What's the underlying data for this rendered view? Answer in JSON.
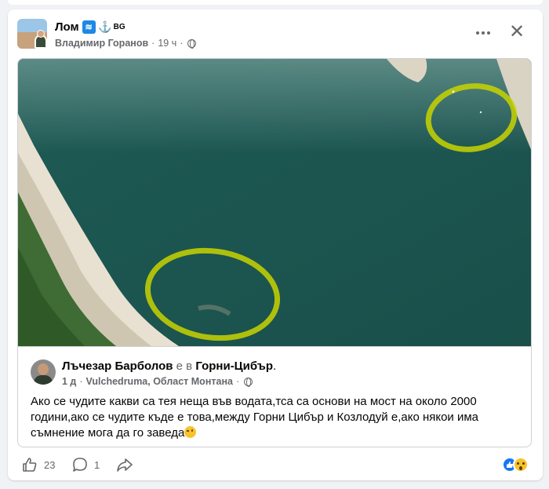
{
  "colors": {
    "accent": "#1877f2",
    "secondary_text": "#65676b",
    "card_bg": "#ffffff",
    "page_bg": "#f0f2f5",
    "highlight": "#c8d400"
  },
  "header": {
    "group_name": "Лом",
    "group_tag": "BG",
    "author": "Владимир Горанов",
    "separator": "·",
    "time": "19 ч",
    "privacy_icon": "globe-icon",
    "more_icon": "more-dots-icon",
    "close_icon": "close-icon",
    "close_glyph": "✕"
  },
  "photo": {
    "description_icon": "river-aerial-photo"
  },
  "shared_post": {
    "author": "Лъчезар Барболов",
    "checkin_text": " е в ",
    "place": "Горни-Цибър",
    "period": ".",
    "time": "1 д",
    "separator": "·",
    "location": "Vulchedruma, Област Монтана",
    "privacy_icon": "globe-icon",
    "text": "Ако се чудите какви са тея неща във водата,тса са основи на мост на около 2000 години,ако се чудите къде е това,между Горни Цибър и Козлодуй е,ако някои има съмнение мога да го заведа"
  },
  "actions": {
    "like_count": "23",
    "comment_count": "1",
    "like_icon": "thumbs-up-icon",
    "comment_icon": "comment-icon",
    "share_icon": "share-icon",
    "reactions": [
      "like-reaction-icon",
      "wow-reaction-icon"
    ]
  }
}
